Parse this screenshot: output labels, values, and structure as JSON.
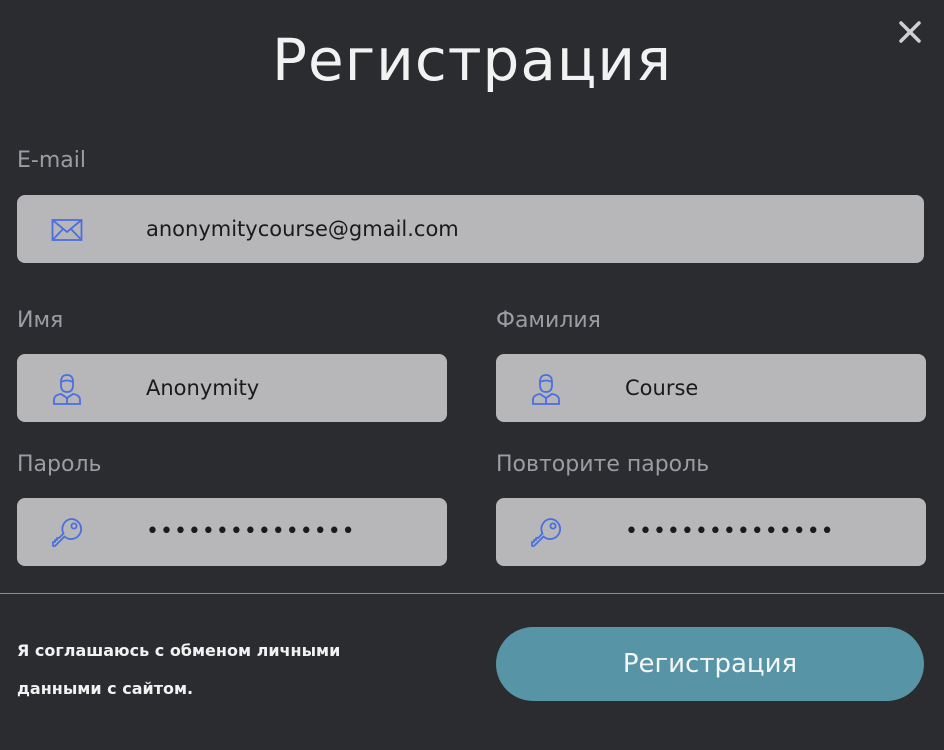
{
  "dialog": {
    "title": "Регистрация",
    "close_icon": "close-icon"
  },
  "form": {
    "email": {
      "label": "E-mail",
      "value": "anonymitycourse@gmail.com",
      "icon": "mail-icon"
    },
    "first_name": {
      "label": "Имя",
      "value": "Anonymity",
      "icon": "user-icon"
    },
    "last_name": {
      "label": "Фамилия",
      "value": "Course",
      "icon": "user-icon"
    },
    "password": {
      "label": "Пароль",
      "value": "•••••••••••••••",
      "icon": "key-icon"
    },
    "password_repeat": {
      "label": "Повторите пароль",
      "value": "•••••••••••••••",
      "icon": "key-icon"
    }
  },
  "footer": {
    "agreement_line1": "Я соглашаюсь с обменом личными",
    "agreement_line2": "данными с сайтом.",
    "submit_label": "Регистрация"
  },
  "colors": {
    "background": "#2b2c30",
    "field": "#b7b7b9",
    "icon": "#4a6fe0",
    "button": "#5794a5"
  }
}
